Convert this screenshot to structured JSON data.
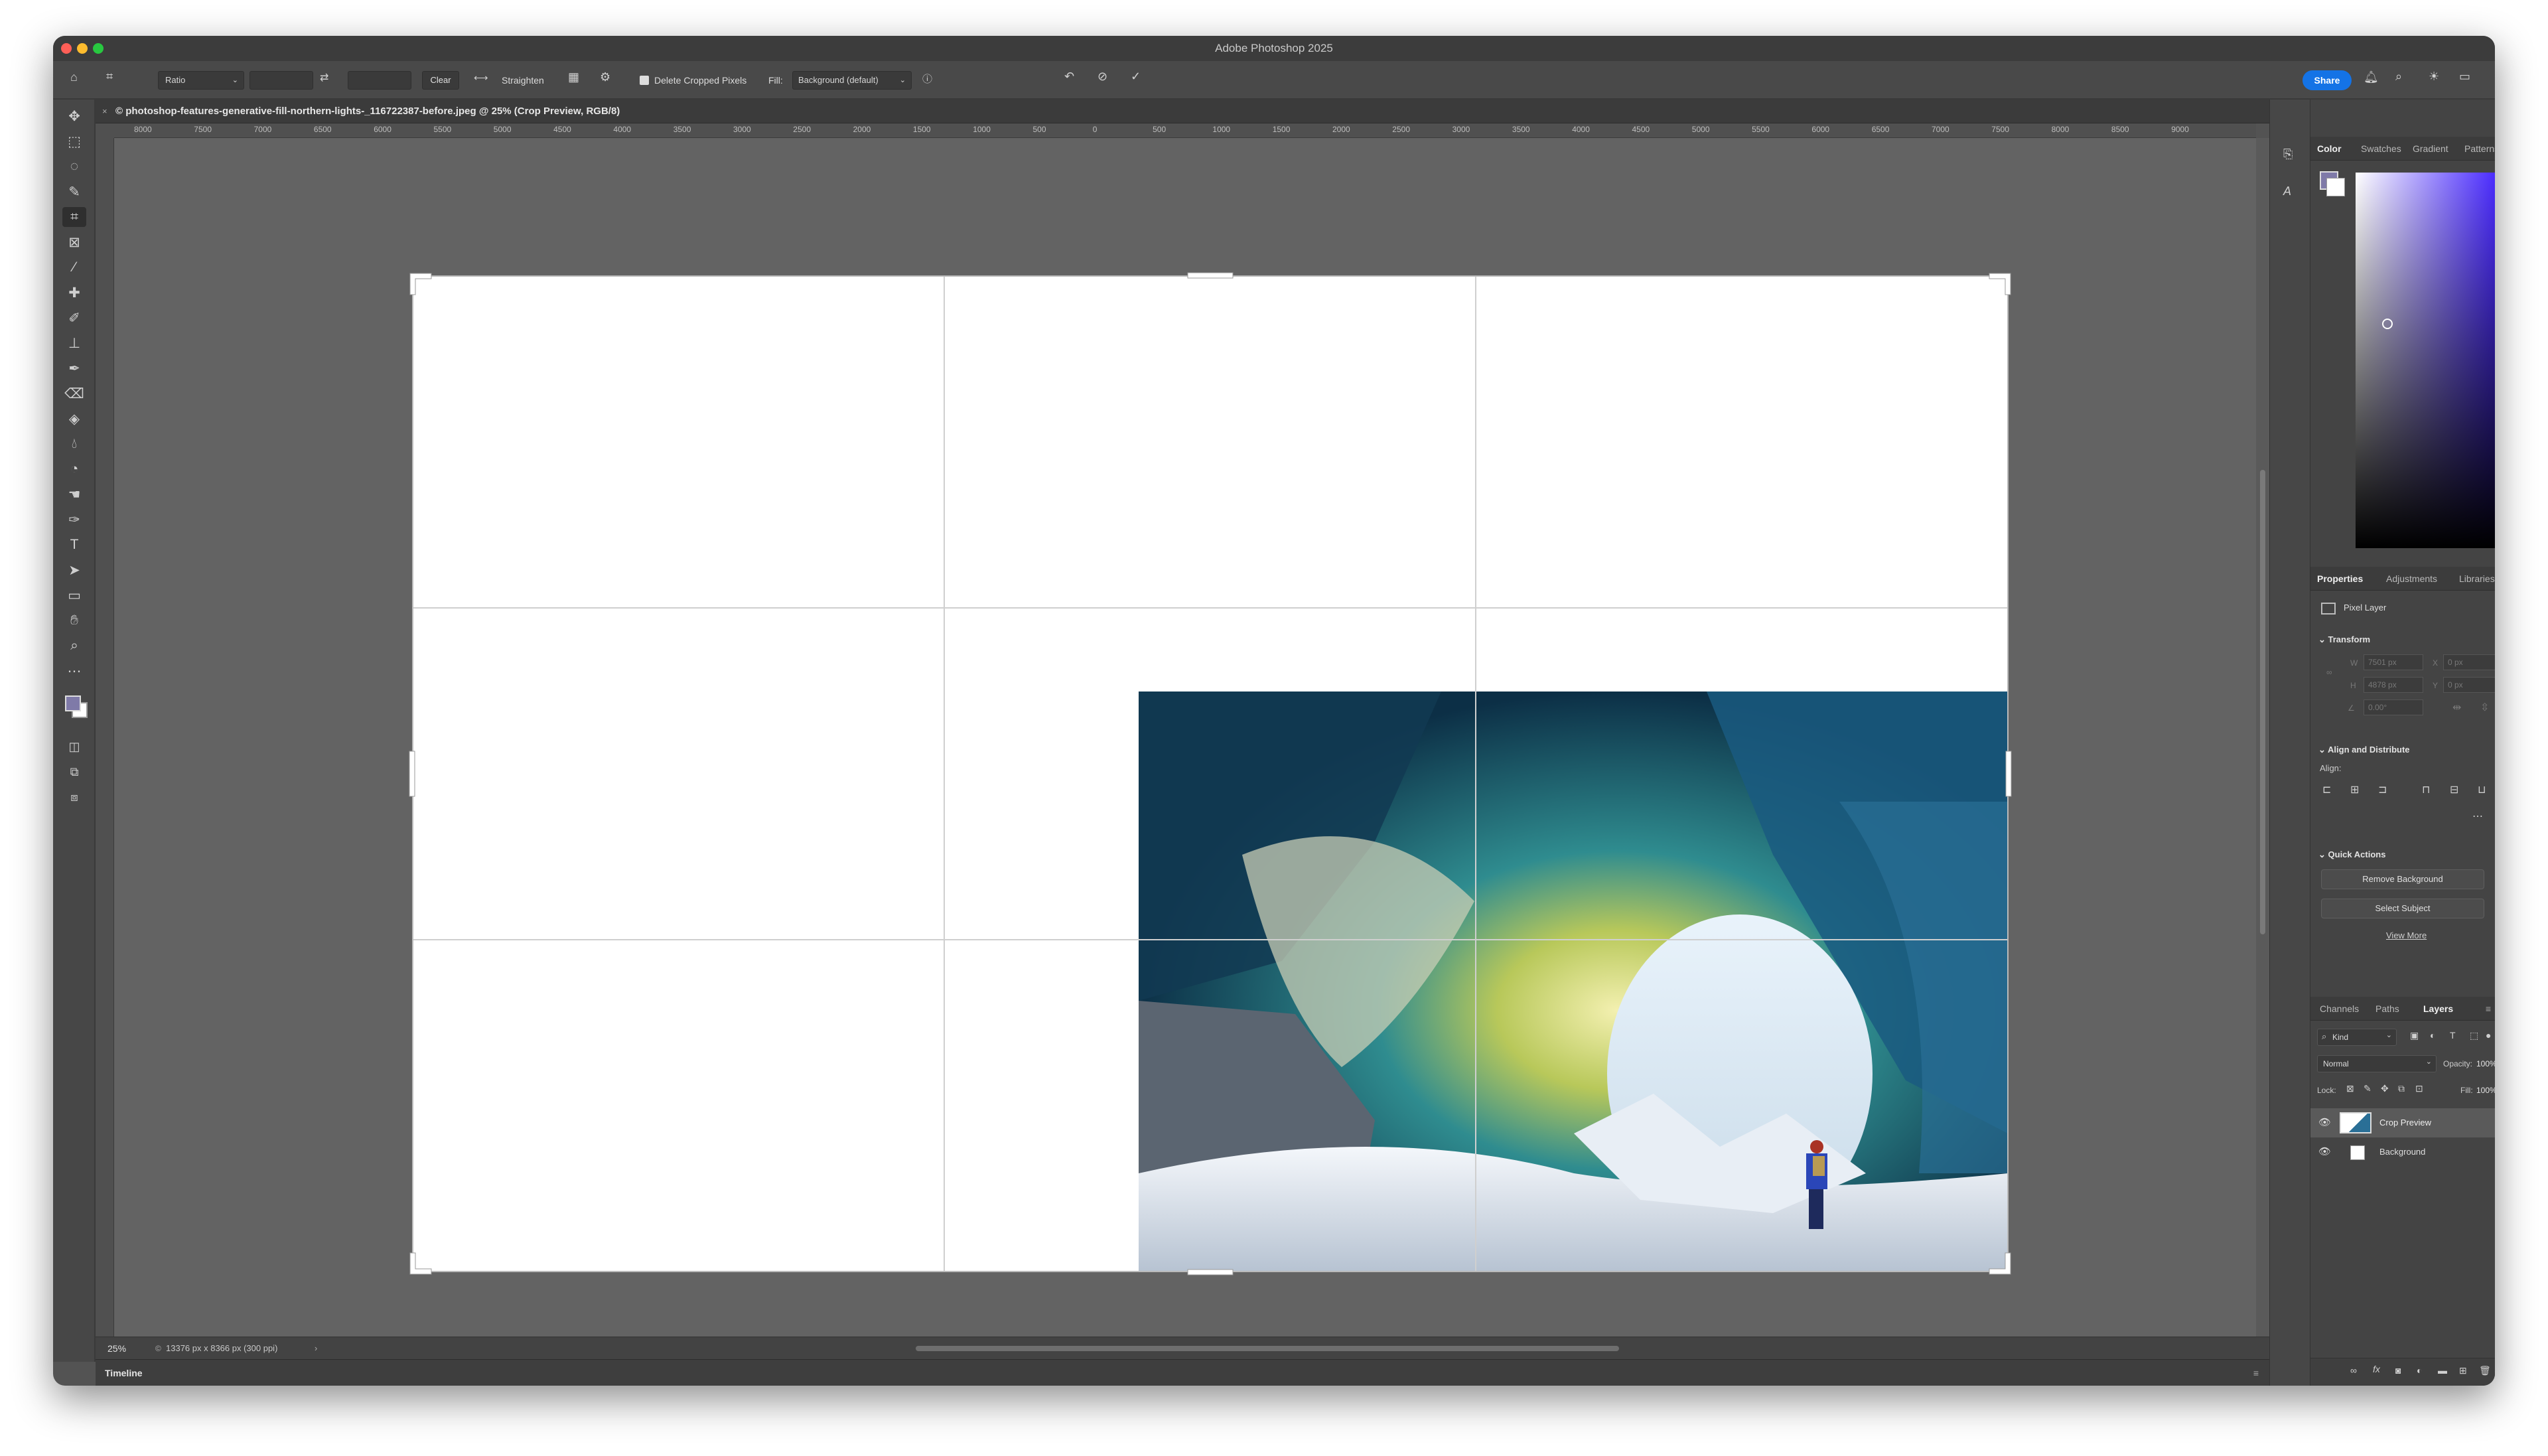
{
  "window": {
    "title": "Adobe Photoshop 2025"
  },
  "options_bar": {
    "ratio": "Ratio",
    "clear": "Clear",
    "straighten": "Straighten",
    "delete_cropped": "Delete Cropped Pixels",
    "fill_label": "Fill:",
    "fill_value": "Background (default)",
    "share": "Share"
  },
  "document": {
    "tab_label": "© photoshop-features-generative-fill-northern-lights-_116722387-before.jpeg @ 25% (Crop Preview, RGB/8)",
    "ruler_ticks": [
      "8000",
      "7500",
      "7000",
      "6500",
      "6000",
      "5500",
      "5000",
      "4500",
      "4000",
      "3500",
      "3000",
      "2500",
      "2000",
      "1500",
      "1000",
      "500",
      "0",
      "500",
      "1000",
      "1500",
      "2000",
      "2500",
      "3000",
      "3500",
      "4000",
      "4500",
      "5000",
      "5500",
      "6000",
      "6500",
      "7000",
      "7500",
      "8000",
      "8500",
      "9000"
    ],
    "zoom": "25%",
    "doc_info": "13376 px x 8366 px (300 ppi)"
  },
  "timeline": {
    "label": "Timeline"
  },
  "color_panel": {
    "tabs": [
      "Color",
      "Swatches",
      "Gradient",
      "Patterns"
    ],
    "active_tab": "Color",
    "hue_base": "#4a2bff"
  },
  "properties_panel": {
    "tabs": [
      "Properties",
      "Adjustments",
      "Libraries"
    ],
    "layer_type": "Pixel Layer",
    "transform": {
      "title": "Transform",
      "w_label": "W",
      "w_value": "7501 px",
      "x_label": "X",
      "x_value": "0 px",
      "h_label": "H",
      "h_value": "4878 px",
      "y_label": "Y",
      "y_value": "0 px",
      "angle_value": "0.00°"
    },
    "align": {
      "title": "Align and Distribute",
      "label": "Align:"
    },
    "quick_actions": {
      "title": "Quick Actions",
      "remove_bg": "Remove Background",
      "select_subject": "Select Subject",
      "view_more": "View More"
    }
  },
  "layers_panel": {
    "tabs": [
      "Channels",
      "Paths",
      "Layers"
    ],
    "active_tab": "Layers",
    "filter": "Kind",
    "blend_mode": "Normal",
    "opacity_label": "Opacity:",
    "opacity_value": "100%",
    "lock_label": "Lock:",
    "fill_label": "Fill:",
    "fill_value": "100%",
    "layers": [
      {
        "name": "Crop Preview",
        "selected": true
      },
      {
        "name": "Background",
        "selected": false
      }
    ]
  },
  "colors": {
    "accent": "#1473e6",
    "canvas_bg": "#636363"
  }
}
